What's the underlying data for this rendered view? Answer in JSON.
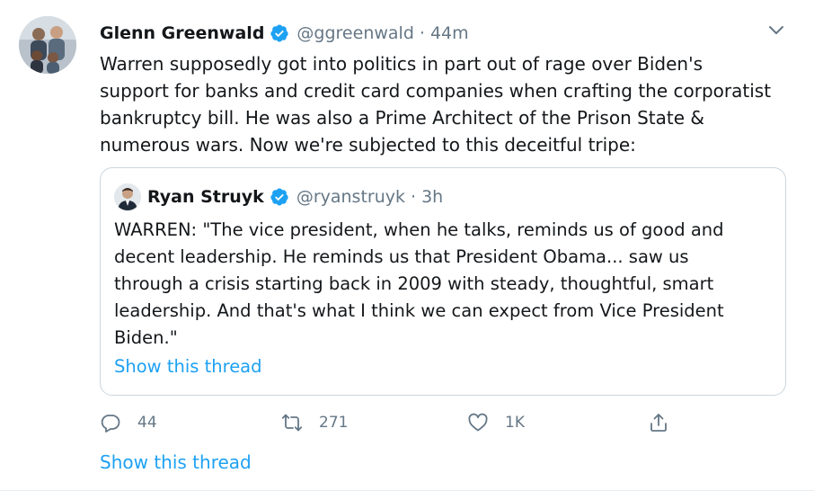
{
  "tweet": {
    "author_name": "Glenn Greenwald",
    "author_handle": "@ggreenwald",
    "separator": "·",
    "timestamp": "44m",
    "text": "Warren supposedly got into politics in part out of rage over Biden's\nsupport for banks and credit card companies when crafting the corporatist\nbankruptcy bill. He was also a Prime Architect of the Prison State &\nnumerous wars. Now we're subjected to this deceitful tripe:",
    "verified": true
  },
  "quoted_tweet": {
    "author_name": "Ryan Struyk",
    "author_handle": "@ryanstruyk",
    "separator": "·",
    "timestamp": "3h",
    "text": "WARREN: \"The vice president, when he talks, reminds us of good and\ndecent leadership. He reminds us that President Obama... saw us\nthrough a crisis starting back in 2009 with steady, thoughtful, smart\nleadership. And that's what I think we can expect from Vice President\nBiden.\"",
    "show_thread_label": "Show this thread",
    "verified": true
  },
  "actions": {
    "reply_count": "44",
    "retweet_count": "271",
    "like_count": "1K",
    "icons": [
      "reply-icon",
      "retweet-icon",
      "like-icon",
      "share-icon"
    ]
  },
  "show_thread_label": "Show this thread",
  "colors": {
    "accent": "#1da1f2",
    "secondary_text": "#657786",
    "primary_text": "#14171a",
    "border": "#ccd6dd"
  }
}
